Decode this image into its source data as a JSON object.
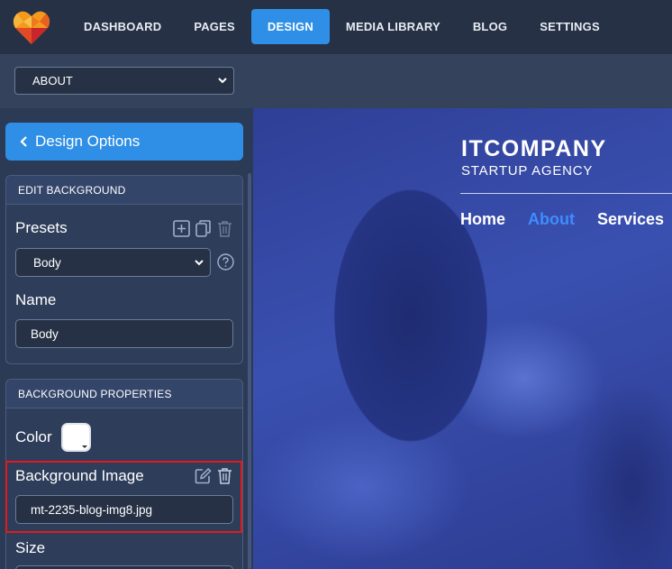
{
  "app": {
    "nav": [
      {
        "label": "DASHBOARD",
        "active": false
      },
      {
        "label": "PAGES",
        "active": false
      },
      {
        "label": "DESIGN",
        "active": true
      },
      {
        "label": "MEDIA LIBRARY",
        "active": false
      },
      {
        "label": "BLOG",
        "active": false
      },
      {
        "label": "SETTINGS",
        "active": false
      }
    ],
    "page_select": {
      "value": "ABOUT"
    }
  },
  "sidebar": {
    "back_label": "Design Options",
    "edit_background": {
      "title": "EDIT BACKGROUND",
      "presets_label": "Presets",
      "presets_value": "Body",
      "name_label": "Name",
      "name_value": "Body"
    },
    "background_properties": {
      "title": "BACKGROUND PROPERTIES",
      "color_label": "Color",
      "color_value": "#ffffff",
      "bg_image_label": "Background Image",
      "bg_image_value": "mt-2235-blog-img8.jpg",
      "size_label": "Size"
    }
  },
  "preview": {
    "brand": "ITCOMPANY",
    "tagline": "STARTUP AGENCY",
    "menu": [
      {
        "label": "Home",
        "active": false
      },
      {
        "label": "About",
        "active": true
      },
      {
        "label": "Services",
        "active": false
      }
    ]
  },
  "colors": {
    "accent": "#2f8fe6",
    "highlight": "#e01b1b",
    "preview_active": "#3f8cff"
  }
}
